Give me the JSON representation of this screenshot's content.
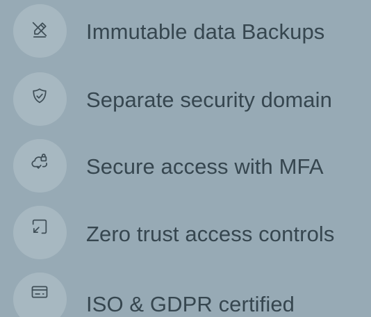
{
  "features": [
    {
      "icon": "pen-off-icon",
      "label": "Immutable data Backups"
    },
    {
      "icon": "shield-check-icon",
      "label": "Separate security domain"
    },
    {
      "icon": "cloud-lock-icon",
      "label": "Secure access with MFA"
    },
    {
      "icon": "expand-arrow-icon",
      "label": "Zero trust access controls"
    },
    {
      "icon": "card-icon",
      "label": "ISO & GDPR certified"
    }
  ]
}
